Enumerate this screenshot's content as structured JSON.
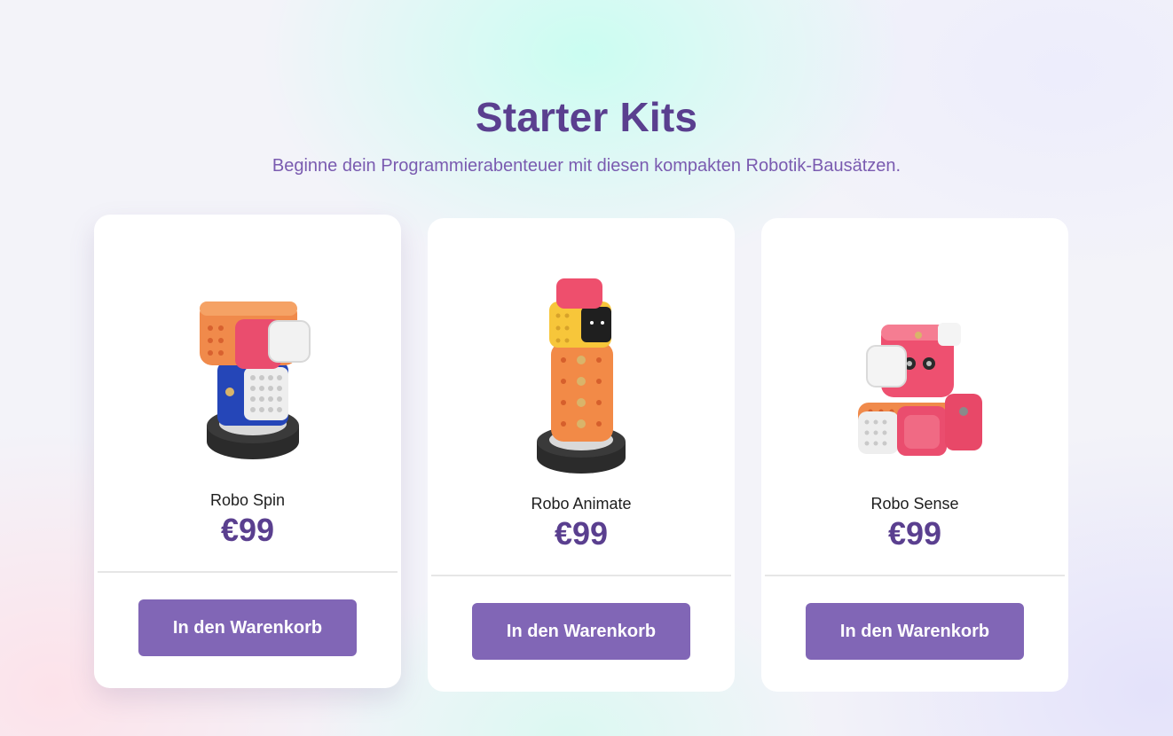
{
  "section": {
    "title": "Starter Kits",
    "subtitle": "Beginne dein Programmierabenteuer mit diesen kompakten Robotik-Bausätzen."
  },
  "products": [
    {
      "name": "Robo Spin",
      "price": "€99",
      "button_label": "In den Warenkorb",
      "image_icon": "robo-spin-image"
    },
    {
      "name": "Robo Animate",
      "price": "€99",
      "button_label": "In den Warenkorb",
      "image_icon": "robo-animate-image"
    },
    {
      "name": "Robo Sense",
      "price": "€99",
      "button_label": "In den Warenkorb",
      "image_icon": "robo-sense-image"
    }
  ],
  "colors": {
    "title": "#5a3f8f",
    "subtitle": "#7a5bb0",
    "button": "#8166b6",
    "card": "#ffffff"
  }
}
